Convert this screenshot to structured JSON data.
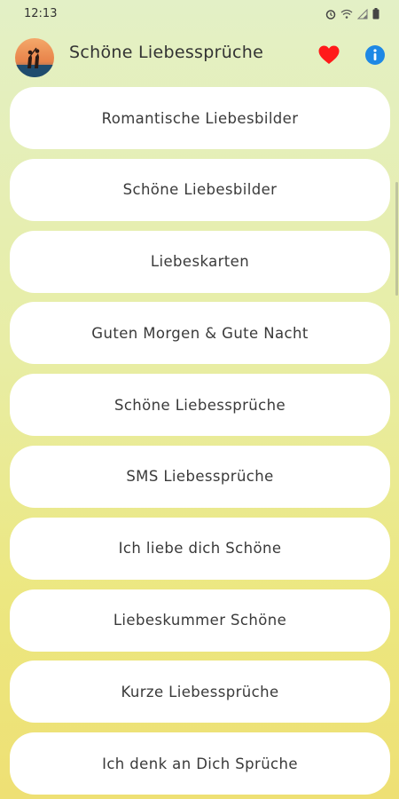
{
  "status_bar": {
    "time": "12:13"
  },
  "app_bar": {
    "title": "Schöne Liebessprüche",
    "heart_color": "#ff1a1a",
    "info_color": "#1e88e5"
  },
  "menu": {
    "items": [
      {
        "label": "Romantische Liebesbilder"
      },
      {
        "label": "Schöne Liebesbilder"
      },
      {
        "label": "Liebeskarten"
      },
      {
        "label": "Guten Morgen & Gute Nacht"
      },
      {
        "label": "Schöne Liebessprüche"
      },
      {
        "label": "SMS Liebessprüche"
      },
      {
        "label": "Ich liebe dich Schöne"
      },
      {
        "label": "Liebeskummer Schöne"
      },
      {
        "label": "Kurze Liebessprüche"
      },
      {
        "label": "Ich denk an Dich Sprüche"
      }
    ]
  }
}
